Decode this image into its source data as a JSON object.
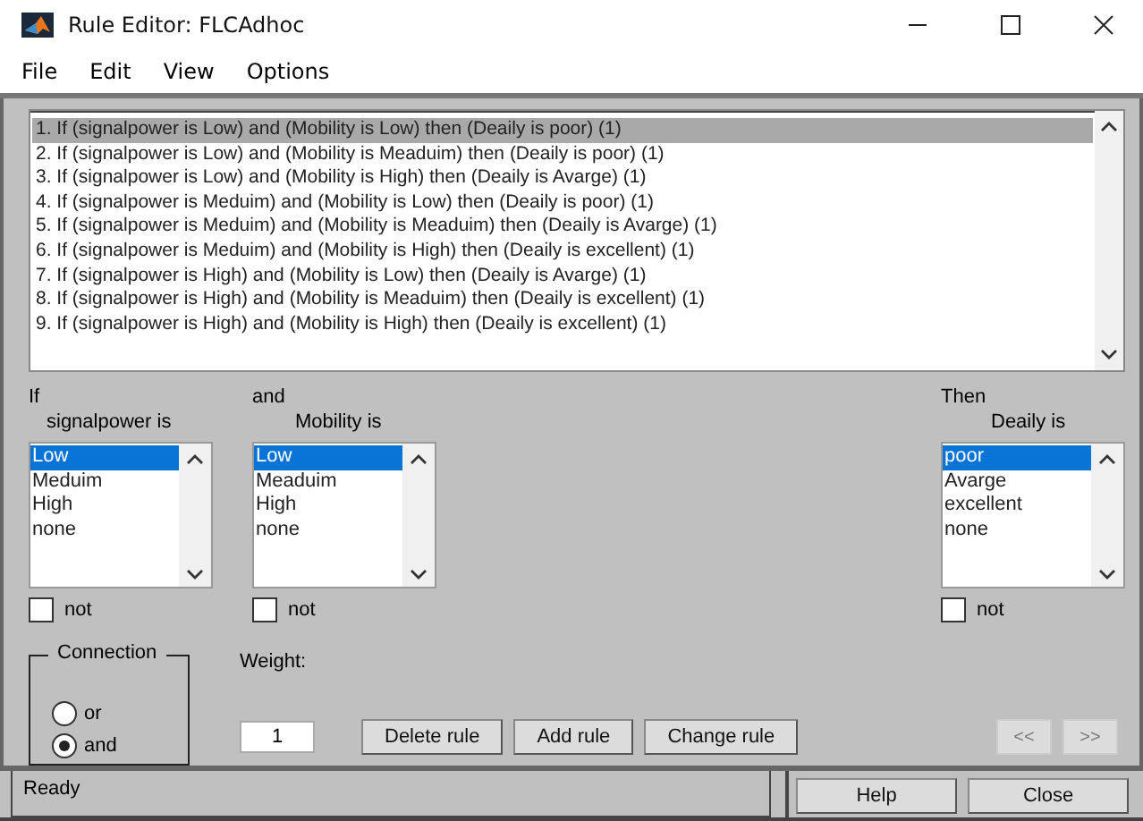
{
  "window": {
    "title": "Rule Editor: FLCAdhoc"
  },
  "menu": [
    "File",
    "Edit",
    "View",
    "Options"
  ],
  "rules": [
    {
      "text": "1. If (signalpower is Low) and (Mobility is Low) then (Deaily is poor) (1)",
      "selected": true
    },
    {
      "text": "2. If (signalpower is Low) and (Mobility is Meaduim) then (Deaily is poor) (1)",
      "selected": false
    },
    {
      "text": "3. If (signalpower is Low) and (Mobility is High) then (Deaily is Avarge) (1)",
      "selected": false
    },
    {
      "text": "4. If (signalpower is Meduim) and (Mobility is Low) then (Deaily is poor) (1)",
      "selected": false
    },
    {
      "text": "5. If (signalpower is Meduim) and (Mobility is Meaduim) then (Deaily is Avarge) (1)",
      "selected": false
    },
    {
      "text": "6. If (signalpower is Meduim) and (Mobility is High) then (Deaily is excellent) (1)",
      "selected": false
    },
    {
      "text": "7. If (signalpower is High) and (Mobility is Low) then (Deaily is Avarge) (1)",
      "selected": false
    },
    {
      "text": "8. If (signalpower is High) and (Mobility is Meaduim) then (Deaily is excellent) (1)",
      "selected": false
    },
    {
      "text": "9. If (signalpower is High) and (Mobility is High) then (Deaily is excellent) (1)",
      "selected": false
    }
  ],
  "variables": [
    {
      "kind": "input",
      "heading": "If",
      "name": "signalpower is",
      "options": [
        {
          "label": "Low",
          "selected": true
        },
        {
          "label": "Meduim",
          "selected": false
        },
        {
          "label": "High",
          "selected": false
        },
        {
          "label": "none",
          "selected": false
        }
      ],
      "not_label": "not",
      "not_checked": false
    },
    {
      "kind": "input",
      "heading": "and",
      "name": "Mobility is",
      "options": [
        {
          "label": "Low",
          "selected": true
        },
        {
          "label": "Meaduim",
          "selected": false
        },
        {
          "label": "High",
          "selected": false
        },
        {
          "label": "none",
          "selected": false
        }
      ],
      "not_label": "not",
      "not_checked": false
    },
    {
      "kind": "output",
      "heading": "Then",
      "name": "Deaily is",
      "options": [
        {
          "label": "poor",
          "selected": true
        },
        {
          "label": "Avarge",
          "selected": false
        },
        {
          "label": "excellent",
          "selected": false
        },
        {
          "label": "none",
          "selected": false
        }
      ],
      "not_label": "not",
      "not_checked": false
    }
  ],
  "connection": {
    "title": "Connection",
    "options": [
      {
        "label": "or",
        "selected": false
      },
      {
        "label": "and",
        "selected": true
      }
    ]
  },
  "weight": {
    "label": "Weight:",
    "value": "1"
  },
  "actions": [
    {
      "label": "Delete rule",
      "disabled": false
    },
    {
      "label": "Add rule",
      "disabled": false
    },
    {
      "label": "Change rule",
      "disabled": false
    }
  ],
  "nav": [
    {
      "label": "<<",
      "disabled": true
    },
    {
      "label": ">>",
      "disabled": true
    }
  ],
  "status": "Ready",
  "footer_buttons": [
    "Help",
    "Close"
  ]
}
